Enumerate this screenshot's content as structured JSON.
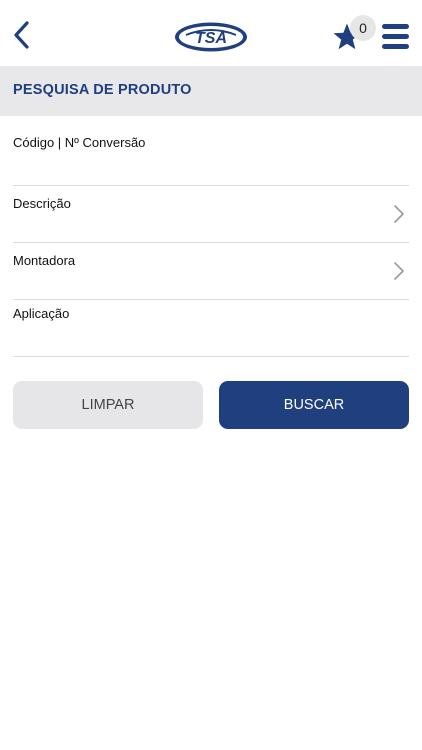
{
  "header": {
    "back_icon": "chevron-left-icon",
    "logo_text": "TSA",
    "favorites_count": "0",
    "favorites_icon": "star-icon",
    "menu_icon": "hamburger-menu-icon"
  },
  "section": {
    "title": "PESQUISA DE PRODUTO"
  },
  "fields": {
    "code_label": "Código | Nº Conversão",
    "description_label": "Descrição",
    "manufacturer_label": "Montadora",
    "application_label": "Aplicação"
  },
  "actions": {
    "clear_label": "LIMPAR",
    "search_label": "BUSCAR"
  },
  "colors": {
    "brand_blue": "#1f3f7f",
    "header_gray": "#e8e8ea",
    "button_gray": "#e6e6e8"
  }
}
